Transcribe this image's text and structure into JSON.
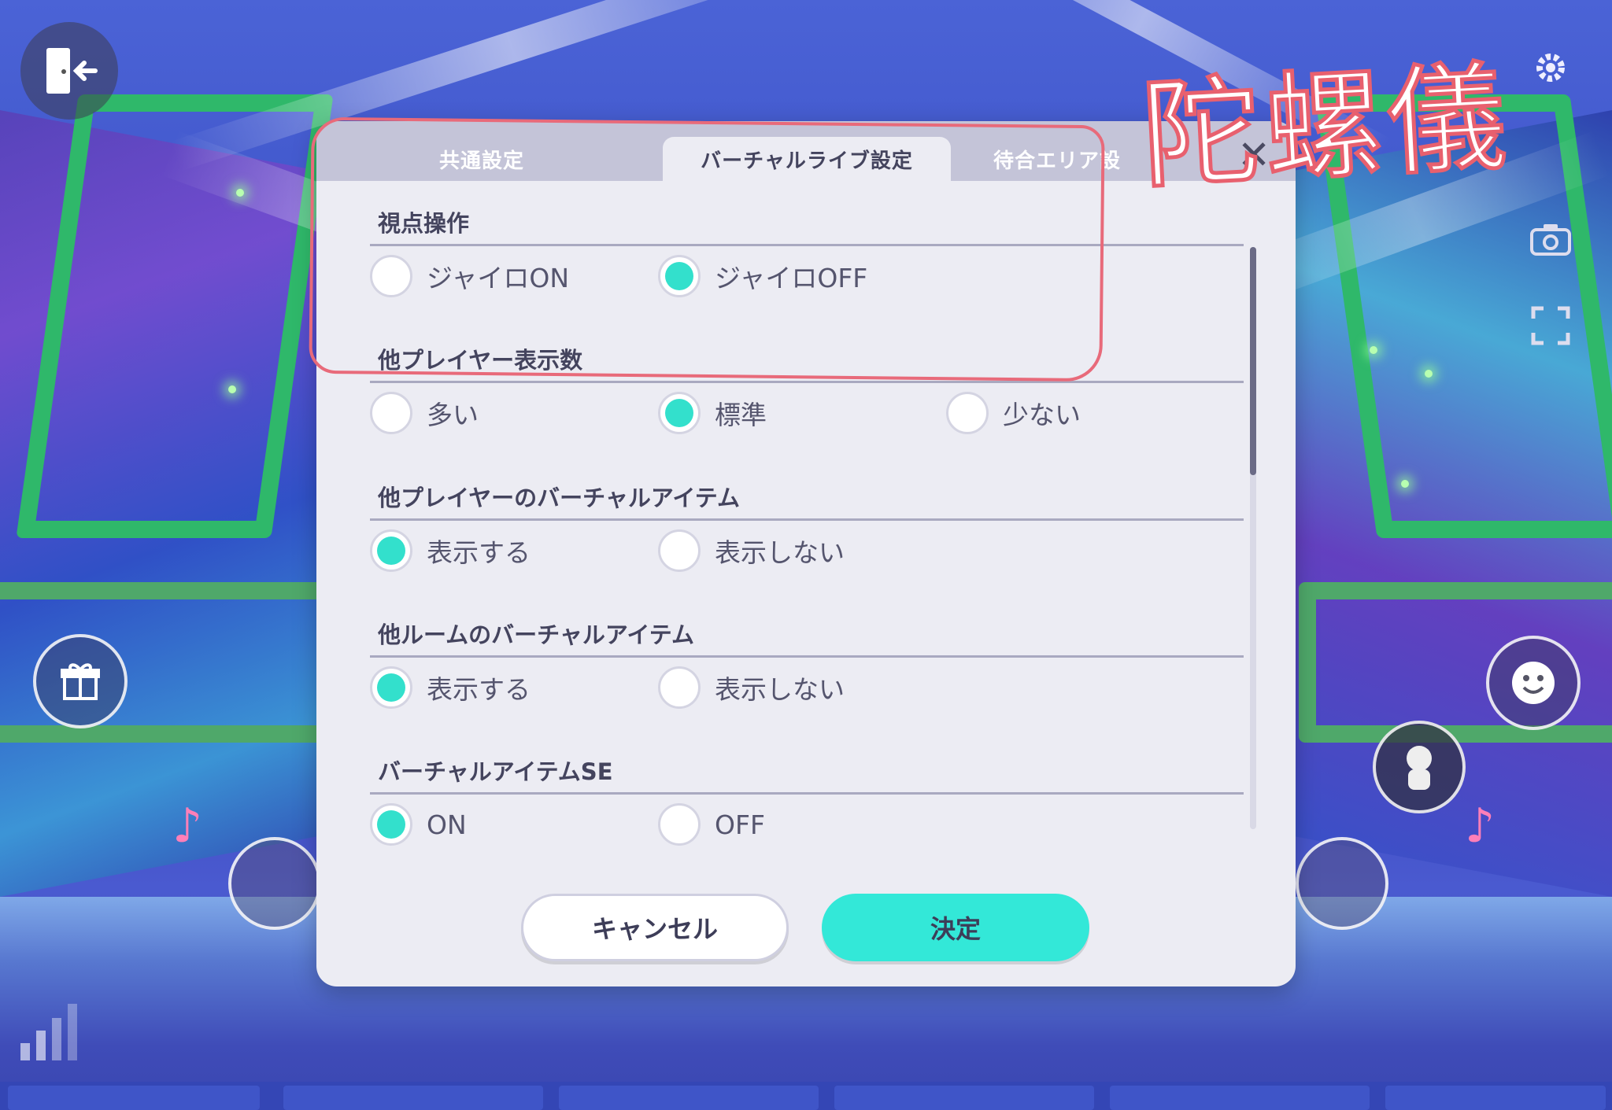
{
  "tabs": [
    {
      "label": "共通設定",
      "active": false
    },
    {
      "label": "バーチャルライブ設定",
      "active": true
    },
    {
      "label": "待合エリア設",
      "active": false
    }
  ],
  "sections": [
    {
      "title": "視点操作",
      "options": [
        {
          "label": "ジャイロON",
          "selected": false
        },
        {
          "label": "ジャイロOFF",
          "selected": true
        }
      ]
    },
    {
      "title": "他プレイヤー表示数",
      "options": [
        {
          "label": "多い",
          "selected": false
        },
        {
          "label": "標準",
          "selected": true
        },
        {
          "label": "少ない",
          "selected": false
        }
      ]
    },
    {
      "title": "他プレイヤーのバーチャルアイテム",
      "options": [
        {
          "label": "表示する",
          "selected": true
        },
        {
          "label": "表示しない",
          "selected": false
        }
      ]
    },
    {
      "title": "他ルームのバーチャルアイテム",
      "options": [
        {
          "label": "表示する",
          "selected": true
        },
        {
          "label": "表示しない",
          "selected": false
        }
      ]
    },
    {
      "title": "バーチャルアイテムSE",
      "options": [
        {
          "label": "ON",
          "selected": true
        },
        {
          "label": "OFF",
          "selected": false
        }
      ]
    }
  ],
  "buttons": {
    "cancel": "キャンセル",
    "ok": "決定"
  },
  "annotation": {
    "text": "陀螺儀",
    "color": "#e8606e"
  },
  "colors": {
    "accent": "#33e8d8",
    "modal_bg": "#ececf3",
    "tab_bar": "#c4c4d8"
  },
  "icons": {
    "exit": "exit-door-icon",
    "settings": "gear-icon",
    "camera": "camera-icon",
    "fullscreen": "fullscreen-icon",
    "gift": "gift-icon",
    "emote": "smile-icon"
  }
}
